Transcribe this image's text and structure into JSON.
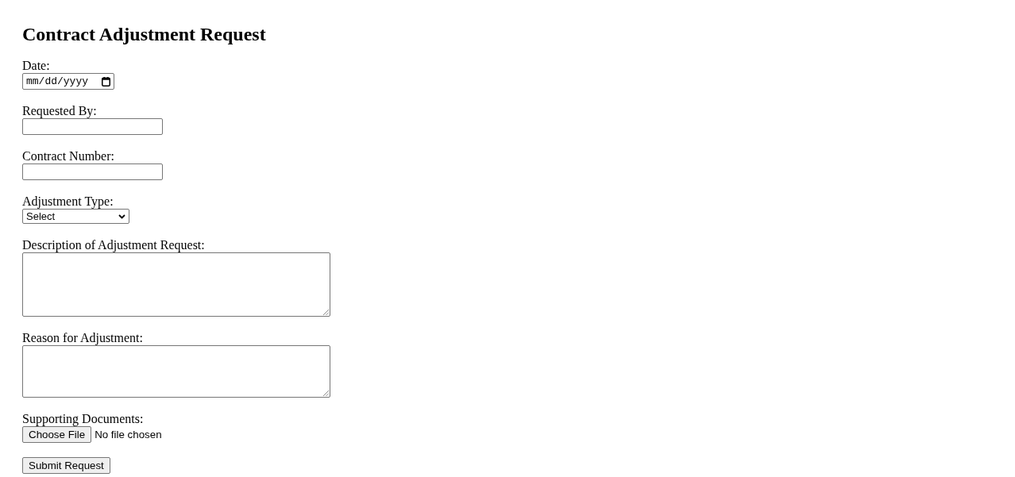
{
  "title": "Contract Adjustment Request",
  "fields": [
    {
      "kind": "date",
      "label": "Date:",
      "placeholder": "mm/dd/yyyy"
    },
    {
      "kind": "text",
      "label": "Requested By:"
    },
    {
      "kind": "text",
      "label": "Contract Number:"
    },
    {
      "kind": "select",
      "label": "Adjustment Type:",
      "value": "Select"
    },
    {
      "kind": "textarea",
      "label": "Description of Adjustment Request:"
    },
    {
      "kind": "textarea",
      "label": "Reason for Adjustment:"
    },
    {
      "kind": "file",
      "label": "Supporting Documents:",
      "button": "Choose File",
      "status": "No file chosen"
    }
  ],
  "submit": "Submit Request"
}
